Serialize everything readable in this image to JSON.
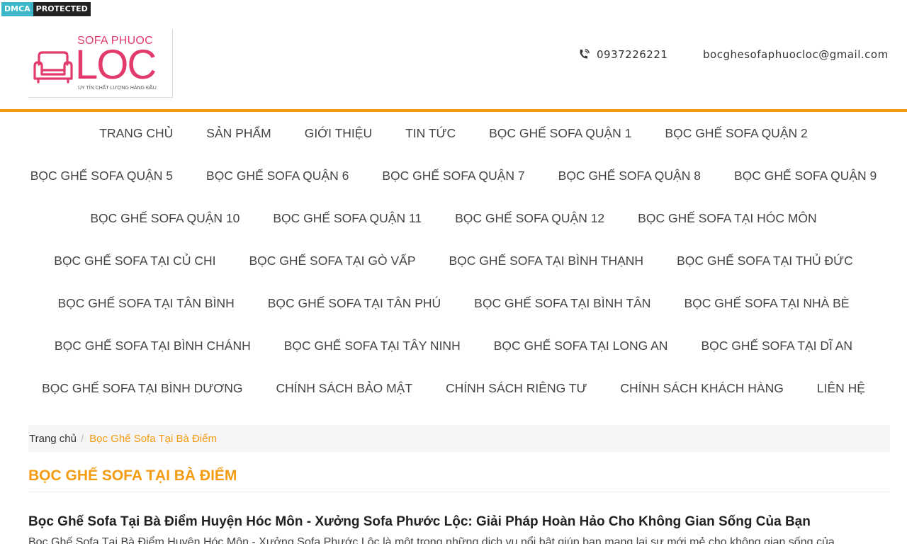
{
  "dmca": {
    "left": "DMCA",
    "right": "PROTECTED"
  },
  "logo": {
    "line1": "SOFA PHUOC",
    "line2": "LOC",
    "tagline": "UY TÍN CHẤT LƯỢNG HÀNG ĐẦU",
    "color": "#e23a6a"
  },
  "header": {
    "phone": "0937226221",
    "email": "bocghesofaphuocloc@gmail.com"
  },
  "accent": "#f39c12",
  "menu": [
    [
      "TRANG CHỦ",
      "SẢN PHẨM",
      "GIỚI THIỆU",
      "TIN TỨC",
      "BỌC GHẾ SOFA QUẬN 1",
      "BỌC GHẾ SOFA QUẬN 2"
    ],
    [
      "BỌC GHẾ SOFA QUẬN 5",
      "BỌC GHẾ SOFA QUẬN 6",
      "BỌC GHẾ SOFA QUẬN 7",
      "BỌC GHẾ SOFA QUẬN 8",
      "BỌC GHẾ SOFA QUẬN 9"
    ],
    [
      "BỌC GHẾ SOFA QUẬN 10",
      "BỌC GHẾ SOFA QUẬN 11",
      "BỌC GHẾ SOFA QUẬN 12",
      "BỌC GHẾ SOFA TẠI HÓC MÔN"
    ],
    [
      "BỌC GHẾ SOFA TẠI CỦ CHI",
      "BỌC GHẾ SOFA TẠI GÒ VẤP",
      "BỌC GHẾ SOFA TẠI BÌNH THẠNH",
      "BỌC GHẾ SOFA TẠI THỦ ĐỨC"
    ],
    [
      "BỌC GHẾ SOFA TẠI TÂN BÌNH",
      "BỌC GHẾ SOFA TẠI TÂN PHÚ",
      "BỌC GHẾ SOFA TẠI BÌNH TÂN",
      "BỌC GHẾ SOFA TẠI NHÀ BÈ"
    ],
    [
      "BỌC GHẾ SOFA TẠI BÌNH CHÁNH",
      "BỌC GHẾ SOFA TẠI TÂY NINH",
      "BỌC GHẾ SOFA TẠI LONG AN",
      "BỌC GHẾ SOFA TẠI DĨ AN"
    ],
    [
      "BỌC GHẾ SOFA TẠI BÌNH DƯƠNG",
      "CHÍNH SÁCH BẢO MẬT",
      "CHÍNH SÁCH RIÊNG TƯ",
      "CHÍNH SÁCH KHÁCH HÀNG",
      "LIÊN HỆ"
    ]
  ],
  "breadcrumb": {
    "home": "Trang chủ",
    "separator": "/",
    "current": "Bọc Ghế Sofa Tại Bà Điểm"
  },
  "page_title": "BỌC GHẾ SOFA TẠI BÀ ĐIỂM",
  "article": {
    "heading": "Bọc Ghế Sofa Tại Bà Điểm Huyện Hóc Môn - Xưởng Sofa Phước Lộc: Giải Pháp Hoàn Hảo Cho Không Gian Sống Của Bạn",
    "text": "Bọc Ghế Sofa Tại Bà Điểm Huyện Hóc Môn - Xưởng Sofa Phước Lộc là một trong những dịch vụ nổi bật giúp bạn mang lại sự mới mẻ cho không gian sống của"
  }
}
